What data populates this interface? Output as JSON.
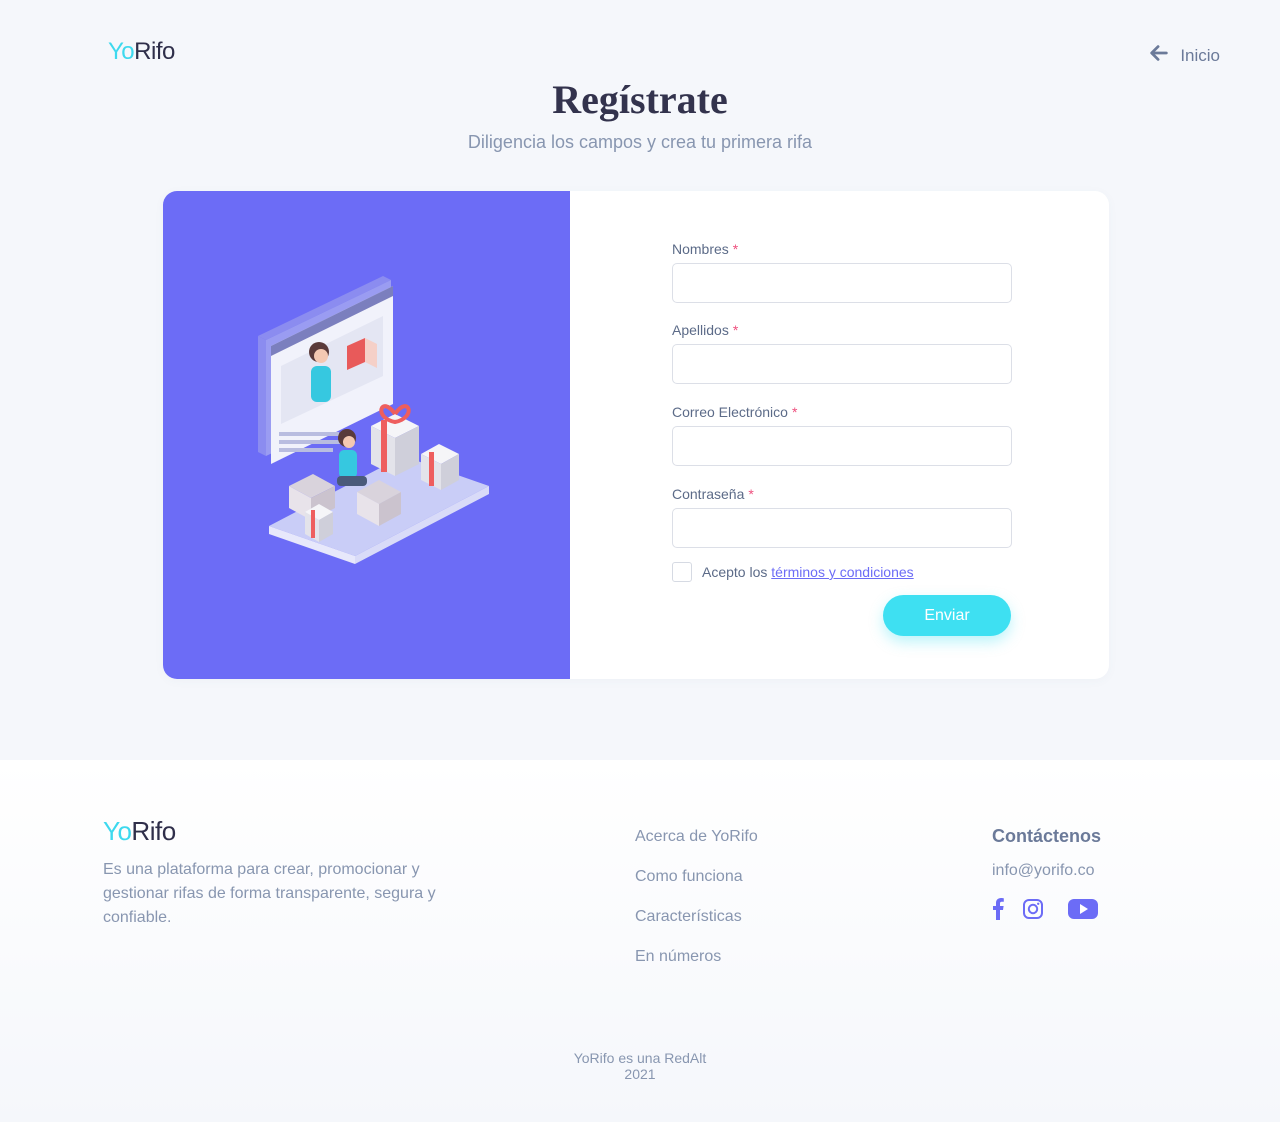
{
  "header": {
    "logo_yo": "Yo",
    "logo_rifo": "Rifo",
    "back_label": "Inicio"
  },
  "page": {
    "title": "Regístrate",
    "subtitle": "Diligencia los campos y crea tu primera rifa"
  },
  "form": {
    "required_mark": "*",
    "fields": [
      {
        "label": "Nombres",
        "value": ""
      },
      {
        "label": "Apellidos",
        "value": ""
      },
      {
        "label": "Correo Electrónico",
        "value": ""
      },
      {
        "label": "Contraseña",
        "value": ""
      }
    ],
    "terms_prefix": "Acepto los",
    "terms_link": "términos y condiciones",
    "submit_label": "Enviar"
  },
  "footer": {
    "logo_yo": "Yo",
    "logo_rifo": "Rifo",
    "description": "Es una plataforma para crear, promocionar y gestionar rifas de forma transparente, segura y confiable.",
    "links": [
      "Acerca de YoRifo",
      "Como funciona",
      "Características",
      "En números"
    ],
    "contact_title": "Contáctenos",
    "contact_email": "info@yorifo.co",
    "social_icons": [
      "facebook-icon",
      "instagram-icon",
      "youtube-icon"
    ],
    "copyright_line1": "YoRifo es una RedAlt",
    "copyright_line2": "2021"
  },
  "colors": {
    "accent_cyan": "#3ee0f2",
    "accent_purple": "#6c6cf6",
    "required_pink": "#ee4f7d"
  }
}
